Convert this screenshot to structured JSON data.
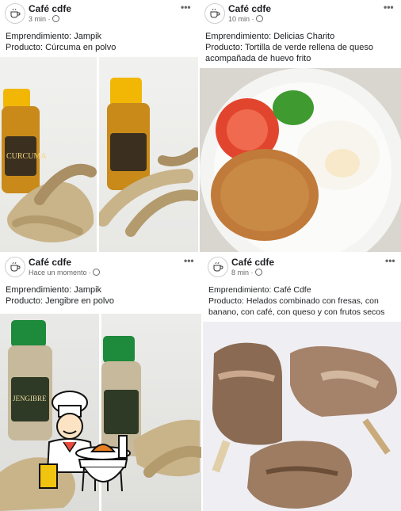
{
  "posts": [
    {
      "page_name": "Café cdfe",
      "time": "3 min",
      "separator": "·",
      "line1": "Emprendimiento: Jampik",
      "line2": "Producto: Cúrcuma en polvo",
      "line3": "",
      "jar_label": "CURCUMA",
      "photo_desc": "turmeric"
    },
    {
      "page_name": "Café cdfe",
      "time": "10 min",
      "separator": "·",
      "line1": "Emprendimiento: Delicias Charito",
      "line2": "Producto: Tortilla de verde rellena de queso",
      "line3": "acompañada de huevo frito",
      "photo_desc": "plate"
    },
    {
      "page_name": "Café cdfe",
      "time": "Hace un momento",
      "separator": "·",
      "line1": "Emprendimiento: Jampik",
      "line2": "Producto: Jengibre en polvo",
      "line3": "",
      "jar_label": "JENGIBRE",
      "photo_desc": "ginger"
    },
    {
      "page_name": "Café cdfe",
      "time": "8 min",
      "separator": "·",
      "line1": "Emprendimiento: Café Cdfe",
      "line2": "Producto: Helados combinado con fresas, con",
      "line3": "banano, con café, con queso y con frutos secos",
      "photo_desc": "ice-cream"
    }
  ],
  "more_label": "•••",
  "colors": {
    "text": "#1c1e21",
    "meta": "#65676b",
    "accent": "#2f6fb6",
    "cap_yellow": "#f2b705",
    "cap_green": "#1e8a3c"
  },
  "icons": {
    "privacy": "globe-icon",
    "menu": "more-options-icon",
    "avatar": "cafe-logo-icon",
    "overlay": "chef-restaurant-icon"
  }
}
